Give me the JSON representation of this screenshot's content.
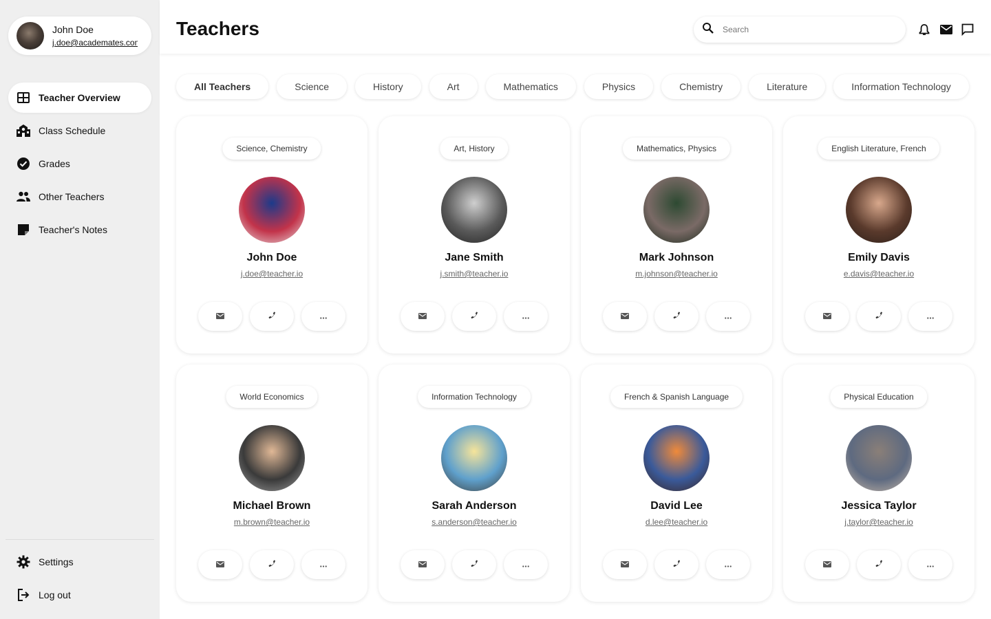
{
  "user": {
    "name": "John Doe",
    "email": "j.doe@academates.com"
  },
  "sidebar": {
    "items": [
      {
        "label": "Teacher Overview",
        "icon": "grid-icon"
      },
      {
        "label": "Class Schedule",
        "icon": "school-icon"
      },
      {
        "label": "Grades",
        "icon": "check-circle-icon"
      },
      {
        "label": "Other Teachers",
        "icon": "people-icon"
      },
      {
        "label": "Teacher's Notes",
        "icon": "note-icon"
      }
    ],
    "bottom": [
      {
        "label": "Settings",
        "icon": "gear-icon"
      },
      {
        "label": "Log out",
        "icon": "logout-icon"
      }
    ]
  },
  "header": {
    "title": "Teachers",
    "search_placeholder": "Search"
  },
  "tabs": [
    "All Teachers",
    "Science",
    "History",
    "Art",
    "Mathematics",
    "Physics",
    "Chemistry",
    "Literature",
    "Information Technology"
  ],
  "teachers": [
    {
      "subject": "Science, Chemistry",
      "name": "John Doe",
      "email": "j.doe@teacher.io",
      "photo_colors": [
        "#1c3a8a",
        "#c2334a",
        "#e8e0e0"
      ]
    },
    {
      "subject": "Art, History",
      "name": "Jane Smith",
      "email": "j.smith@teacher.io",
      "photo_colors": [
        "#cfcfcf",
        "#5a5a5a",
        "#222222"
      ]
    },
    {
      "subject": "Mathematics, Physics",
      "name": "Mark Johnson",
      "email": "m.johnson@teacher.io",
      "photo_colors": [
        "#2d4a32",
        "#7a6a66",
        "#1a2a1c"
      ]
    },
    {
      "subject": "English Literature, French",
      "name": "Emily Davis",
      "email": "e.davis@teacher.io",
      "photo_colors": [
        "#d8a88c",
        "#5a3a2c",
        "#2a1e18"
      ]
    },
    {
      "subject": "World Economics",
      "name": "Michael Brown",
      "email": "m.brown@teacher.io",
      "photo_colors": [
        "#e0b896",
        "#3a3a3a",
        "#a0a0a0"
      ]
    },
    {
      "subject": "Information Technology",
      "name": "Sarah Anderson",
      "email": "s.anderson@teacher.io",
      "photo_colors": [
        "#f6e49a",
        "#5fa0cc",
        "#3c3a36"
      ]
    },
    {
      "subject": "French & Spanish Language",
      "name": "David Lee",
      "email": "d.lee@teacher.io",
      "photo_colors": [
        "#f08a3a",
        "#3a5a9a",
        "#3a2420"
      ]
    },
    {
      "subject": "Physical Education",
      "name": "Jessica Taylor",
      "email": "j.taylor@teacher.io",
      "photo_colors": [
        "#8a7f78",
        "#5e6a80",
        "#c8b8a8"
      ]
    }
  ]
}
